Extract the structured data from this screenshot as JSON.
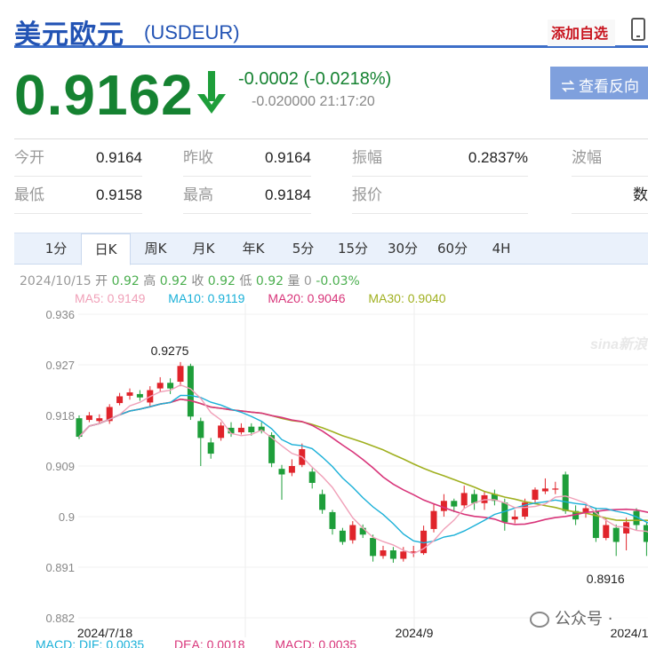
{
  "header": {
    "title": "美元欧元",
    "code": "(USDEUR)",
    "add_favorite": "添加自选",
    "reverse_button": "查看反向汇"
  },
  "quote": {
    "price": "0.9162",
    "change": "-0.0002 (-0.0218%)",
    "sub_line": "-0.020000 21:17:20"
  },
  "stats": [
    {
      "label": "今开",
      "value": "0.9164"
    },
    {
      "label": "昨收",
      "value": "0.9164"
    },
    {
      "label": "振幅",
      "value": "0.2837%"
    },
    {
      "label": "波幅",
      "value": ""
    },
    {
      "label": "最低",
      "value": "0.9158"
    },
    {
      "label": "最高",
      "value": "0.9184"
    },
    {
      "label": "报价",
      "value": ""
    },
    {
      "label": "",
      "value": "数"
    }
  ],
  "tabs": [
    "1分",
    "日K",
    "周K",
    "月K",
    "年K",
    "5分",
    "15分",
    "30分",
    "60分",
    "4H"
  ],
  "active_tab": "日K",
  "bar_info": {
    "date": "2024/10/15",
    "open_label": "开",
    "open": "0.92",
    "high_label": "高",
    "high": "0.92",
    "close_label": "收",
    "close": "0.92",
    "low_label": "低",
    "low": "0.92",
    "vol_label": "量",
    "vol": "0",
    "pct": "-0.03%"
  },
  "ma_legend": [
    {
      "text": "MA5: 0.9149",
      "color": "#f0a0b8"
    },
    {
      "text": "MA10: 0.9119",
      "color": "#1ab0d8"
    },
    {
      "text": "MA20: 0.9046",
      "color": "#d8357a"
    },
    {
      "text": "MA30: 0.9040",
      "color": "#a0b020"
    }
  ],
  "macd_legend": [
    {
      "text": "MACD: DIF: 0.0035",
      "color": "#1ab0d8"
    },
    {
      "text": "DEA: 0.0018",
      "color": "#d8357a"
    },
    {
      "text": "MACD: 0.0035",
      "color": "#d8357a"
    }
  ],
  "watermark": "公众号 ·",
  "sina_logo": "sina新浪",
  "colors": {
    "up": "#e0242b",
    "down": "#1e9e3a",
    "price_green": "#158231",
    "title_blue": "#2253b4",
    "ma5": "#f0a0b8",
    "ma10": "#1ab0d8",
    "ma20": "#d8357a",
    "ma30": "#a0b020"
  },
  "chart_data": {
    "type": "candlestick",
    "ylim": [
      0.882,
      0.936
    ],
    "y_ticks": [
      "0.936",
      "0.927",
      "0.918",
      "0.909",
      "0.9",
      "0.891",
      "0.882"
    ],
    "x_labels": [
      "2024/7/18",
      "2024/9",
      "2024/1"
    ],
    "annotations": [
      {
        "text": "0.9275",
        "value": 0.9275,
        "index": 10
      },
      {
        "text": "0.8916",
        "value": 0.8916,
        "index": 53
      }
    ],
    "candles": [
      [
        0.9175,
        0.9142,
        0.918,
        0.9138
      ],
      [
        0.9172,
        0.918,
        0.9186,
        0.9168
      ],
      [
        0.917,
        0.9175,
        0.9182,
        0.9165
      ],
      [
        0.917,
        0.9195,
        0.92,
        0.9165
      ],
      [
        0.9202,
        0.9214,
        0.922,
        0.9198
      ],
      [
        0.9215,
        0.9221,
        0.9228,
        0.9208
      ],
      [
        0.9218,
        0.9212,
        0.9225,
        0.9206
      ],
      [
        0.9203,
        0.9225,
        0.9232,
        0.9196
      ],
      [
        0.9228,
        0.9238,
        0.9248,
        0.9222
      ],
      [
        0.9238,
        0.9228,
        0.9246,
        0.9218
      ],
      [
        0.924,
        0.9268,
        0.9275,
        0.9232
      ],
      [
        0.9268,
        0.9178,
        0.9272,
        0.9172
      ],
      [
        0.917,
        0.914,
        0.9176,
        0.909
      ],
      [
        0.9132,
        0.9112,
        0.914,
        0.9103
      ],
      [
        0.914,
        0.9162,
        0.9168,
        0.9135
      ],
      [
        0.9158,
        0.9148,
        0.9168,
        0.9142
      ],
      [
        0.915,
        0.9158,
        0.9166,
        0.9146
      ],
      [
        0.916,
        0.915,
        0.9166,
        0.9144
      ],
      [
        0.916,
        0.9152,
        0.9168,
        0.9148
      ],
      [
        0.9145,
        0.9095,
        0.915,
        0.9088
      ],
      [
        0.9085,
        0.9075,
        0.9092,
        0.903
      ],
      [
        0.9078,
        0.909,
        0.9102,
        0.9072
      ],
      [
        0.9092,
        0.912,
        0.913,
        0.9088
      ],
      [
        0.908,
        0.906,
        0.9086,
        0.905
      ],
      [
        0.904,
        0.9012,
        0.9048,
        0.9005
      ],
      [
        0.9008,
        0.8978,
        0.9012,
        0.8968
      ],
      [
        0.8975,
        0.8955,
        0.898,
        0.895
      ],
      [
        0.8958,
        0.8985,
        0.8992,
        0.8952
      ],
      [
        0.898,
        0.8968,
        0.8986,
        0.8962
      ],
      [
        0.8962,
        0.893,
        0.8968,
        0.892
      ],
      [
        0.893,
        0.894,
        0.8948,
        0.8925
      ],
      [
        0.894,
        0.8925,
        0.8946,
        0.8918
      ],
      [
        0.8925,
        0.8938,
        0.8946,
        0.892
      ],
      [
        0.8936,
        0.8938,
        0.8948,
        0.8928
      ],
      [
        0.8935,
        0.8975,
        0.8984,
        0.8932
      ],
      [
        0.8978,
        0.901,
        0.9022,
        0.8972
      ],
      [
        0.901,
        0.9028,
        0.904,
        0.9
      ],
      [
        0.9028,
        0.9018,
        0.9032,
        0.9008
      ],
      [
        0.902,
        0.9042,
        0.9055,
        0.9015
      ],
      [
        0.904,
        0.9024,
        0.9048,
        0.9012
      ],
      [
        0.9024,
        0.9038,
        0.9045,
        0.9012
      ],
      [
        0.904,
        0.9028,
        0.9048,
        0.902
      ],
      [
        0.9025,
        0.899,
        0.9032,
        0.8975
      ],
      [
        0.8995,
        0.9,
        0.9012,
        0.8988
      ],
      [
        0.9,
        0.9025,
        0.9032,
        0.8995
      ],
      [
        0.903,
        0.9048,
        0.9052,
        0.9022
      ],
      [
        0.9045,
        0.905,
        0.9068,
        0.904
      ],
      [
        0.9048,
        0.905,
        0.9062,
        0.904
      ],
      [
        0.9075,
        0.901,
        0.908,
        0.9005
      ],
      [
        0.901,
        0.8995,
        0.902,
        0.8985
      ],
      [
        0.9008,
        0.9015,
        0.9022,
        0.8998
      ],
      [
        0.901,
        0.8962,
        0.9016,
        0.8955
      ],
      [
        0.8962,
        0.8985,
        0.8998,
        0.8958
      ],
      [
        0.898,
        0.8955,
        0.8986,
        0.893
      ],
      [
        0.897,
        0.899,
        0.8998,
        0.894
      ],
      [
        0.901,
        0.8985,
        0.9015,
        0.8975
      ],
      [
        0.8985,
        0.8955,
        0.899,
        0.893
      ],
      [
        0.896,
        0.8935,
        0.8968,
        0.8916
      ],
      [
        0.8935,
        0.896,
        0.8965,
        0.893
      ],
      [
        0.8965,
        0.8945,
        0.897,
        0.893
      ],
      [
        0.895,
        0.8962,
        0.8968,
        0.894
      ],
      [
        0.896,
        0.8935,
        0.8968,
        0.893
      ],
      [
        0.8935,
        0.895,
        0.8958,
        0.8922
      ],
      [
        0.8958,
        0.8945,
        0.8963,
        0.8936
      ],
      [
        0.8942,
        0.892,
        0.895,
        0.8916
      ],
      [
        0.8925,
        0.894,
        0.8946,
        0.8918
      ],
      [
        0.8942,
        0.893,
        0.8948,
        0.8925
      ],
      [
        0.8935,
        0.8925,
        0.8945,
        0.8916
      ],
      [
        0.8935,
        0.897,
        0.8975,
        0.893
      ],
      [
        0.8975,
        0.9005,
        0.9012,
        0.897
      ],
      [
        0.9015,
        0.8998,
        0.9025,
        0.899
      ],
      [
        0.9008,
        0.903,
        0.904,
        0.9002
      ],
      [
        0.903,
        0.904,
        0.9048,
        0.9025
      ]
    ]
  }
}
